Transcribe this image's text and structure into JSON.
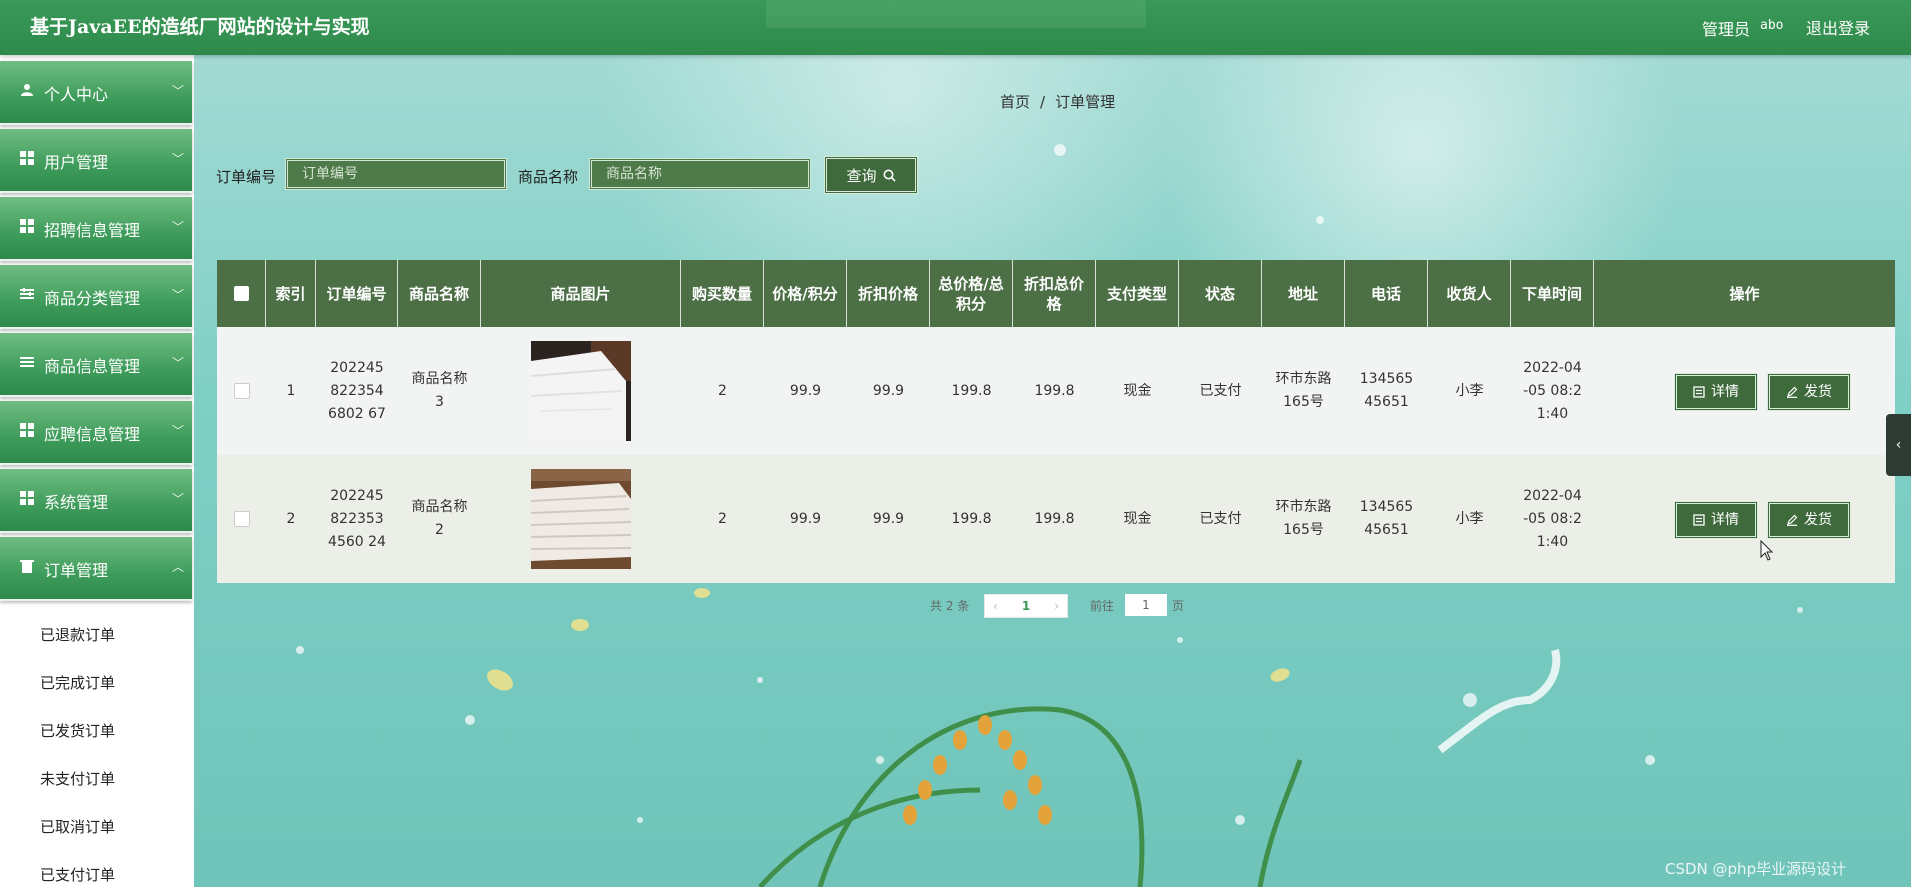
{
  "header": {
    "title": "基于JavaEE的造纸厂网站的设计与实现",
    "admin_label": "管理员",
    "admin_name": "abo",
    "logout": "退出登录"
  },
  "sidebar": {
    "items": [
      {
        "label": "个人中心",
        "icon": "user-icon"
      },
      {
        "label": "用户管理",
        "icon": "grid-icon"
      },
      {
        "label": "招聘信息管理",
        "icon": "grid-icon"
      },
      {
        "label": "商品分类管理",
        "icon": "sliders-icon"
      },
      {
        "label": "商品信息管理",
        "icon": "list-icon"
      },
      {
        "label": "应聘信息管理",
        "icon": "grid-icon"
      },
      {
        "label": "系统管理",
        "icon": "grid-icon"
      },
      {
        "label": "订单管理",
        "icon": "trash-icon"
      }
    ],
    "sub_items": [
      "已退款订单",
      "已完成订单",
      "已发货订单",
      "未支付订单",
      "已取消订单",
      "已支付订单"
    ]
  },
  "breadcrumb": {
    "home": "首页",
    "sep": "/",
    "current": "订单管理"
  },
  "search": {
    "order_no_label": "订单编号",
    "order_no_placeholder": "订单编号",
    "product_label": "商品名称",
    "product_placeholder": "商品名称",
    "query_label": "查询"
  },
  "table": {
    "headers": [
      "索引",
      "订单编号",
      "商品名称",
      "商品图片",
      "购买数量",
      "价格/积分",
      "折扣价格",
      "总价格/总积分",
      "折扣总价格",
      "支付类型",
      "状态",
      "地址",
      "电话",
      "收货人",
      "下单时间",
      "操作"
    ],
    "rows": [
      {
        "index": "1",
        "order_no": "2022458223546802 67",
        "product": "商品名称3",
        "qty": "2",
        "price": "99.9",
        "discount_price": "99.9",
        "total": "199.8",
        "discount_total": "199.8",
        "pay_type": "现金",
        "status": "已支付",
        "address": "环市东路165号",
        "phone": "13456545651",
        "receiver": "小李",
        "time": "2022-04-05 08:21:40"
      },
      {
        "index": "2",
        "order_no": "2022458223534560 24",
        "product": "商品名称2",
        "qty": "2",
        "price": "99.9",
        "discount_price": "99.9",
        "total": "199.8",
        "discount_total": "199.8",
        "pay_type": "现金",
        "status": "已支付",
        "address": "环市东路165号",
        "phone": "13456545651",
        "receiver": "小李",
        "time": "2022-04-05 08:21:40"
      }
    ],
    "detail_label": "详情",
    "ship_label": "发货"
  },
  "pagination": {
    "total_prefix": "共",
    "total": "2",
    "total_suffix": "条",
    "current_page": "1",
    "goto_label": "前往",
    "goto_value": "1",
    "page_suffix": "页"
  },
  "watermark": "CSDN @php毕业源码设计",
  "colors": {
    "primary": "#2e8a4b",
    "table_header": "#4c6f46",
    "button": "#3f6a3c"
  }
}
